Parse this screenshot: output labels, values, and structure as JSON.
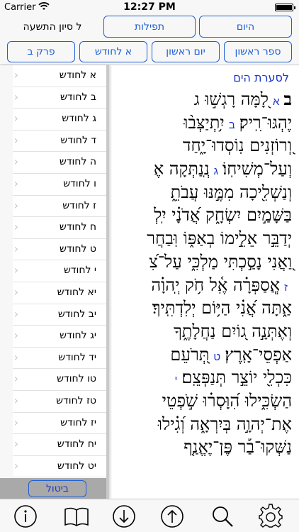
{
  "status_bar": {
    "carrier": "Carrier",
    "time": "12:27 PM"
  },
  "header": {
    "date": "ל סיון התשעה",
    "today_button": "היום",
    "prayers_button": "תפילות",
    "book_first_button": "ספר ראשון",
    "day_first_button": "יום ראשון",
    "month_day_button": "א לחודש",
    "chapter_button": "פרק ב"
  },
  "main": {
    "chapter_link": "לסערת הים",
    "lines": [
      {
        "text": "לָ֭מָּה רָגְשׁ֣וּ ג",
        "num": "א",
        "prefix": "ב"
      },
      {
        "text": "יֶהְגּוּ־רִֽיק׃",
        "num": "ב",
        "tail": "יִ֥תְיַצְּב֨וּ"
      },
      {
        "text": "וְ֭רוֹזְנִים נֽוֹסְדוּ־יָ֑חַד"
      },
      {
        "text": "וְעַל־מְשִׁיחֽוֹ׃",
        "num": "ג",
        "tail": "נְֽנַתְּקָה אֶ"
      },
      {
        "text": "וְנַשְׁלִ֖יכָה מִמֶּ֣נּוּ עֲבֹתֵ֑"
      },
      {
        "text": "בַּשָּׁמַ֣יִם יִשְׂחָ֑ק אֲ֝דֹנָ֗י יִֽלְ"
      },
      {
        "text": "יְדַבֵּ֣ר אֵלֵ֣ימוֹ בְאַפּ֑וֹ וּֽבַחֲר"
      },
      {
        "text": "וַ֭אֲנִי נָסַ֣כְתִּי מַלְכִּ֑י עַל־צִ֝"
      },
      {
        "text": "אֲֽסַפְּרָ֗ה אֶֽ֫ל חֹ֥ק יְֽהוָ֗ה",
        "num": "ז"
      },
      {
        "text": "אַ֑תָּה אֲ֝נִ֗י הַיּ֥וֹם יְלִדְתִּֽיךָ׃"
      },
      {
        "text": "וְאֶתְּנָ֣ה ג֭וֹיִם נַחֲלָתֶ֑ךָ"
      },
      {
        "text": "אַפְסֵי־אָֽרֶץ׃",
        "num": "ט",
        "tail": "תְּ֭רֹעֵם"
      },
      {
        "text": "כִּכְלִ֖י יוֹצֵ֣ר תְּנַפְּצֵֽם׃",
        "num": "י"
      },
      {
        "text": "הַשְׂכִּ֑ילוּ הִ֝וָּסְר֗וּ שֹׁ֣פְטֵי"
      },
      {
        "text": "אֶת־יְהוָ֣ה בְּיִרְאָ֑ה וְ֝גִ֗ילוּ"
      },
      {
        "text": "נַשְּׁקוּ־בַ֡ר פֶּן־יֶאֱנַ֤ף"
      }
    ]
  },
  "sidebar": {
    "items": [
      "א לחודש",
      "ב לחודש",
      "ג לחודש",
      "ד לחודש",
      "ה לחודש",
      "ו לחודש",
      "ז לחודש",
      "ח לחודש",
      "ט לחודש",
      "י לחודש",
      "יא לחודש",
      "יב לחודש",
      "יג לחודש",
      "יד לחודש",
      "טו לחודש",
      "טז לחודש",
      "יז לחודש",
      "יח לחודש",
      "יט לחודש"
    ],
    "chevron": "›",
    "cancel_button": "ביטול"
  },
  "bottom_toolbar": {
    "icons": [
      "info-icon",
      "book-icon",
      "arrow-down-icon",
      "arrow-up-icon",
      "search-icon",
      "gear-icon"
    ]
  },
  "colors": {
    "accent": "#1c5fd6",
    "verse_number": "#1c34c8",
    "toolbar_bg": "#f7f7f7"
  }
}
